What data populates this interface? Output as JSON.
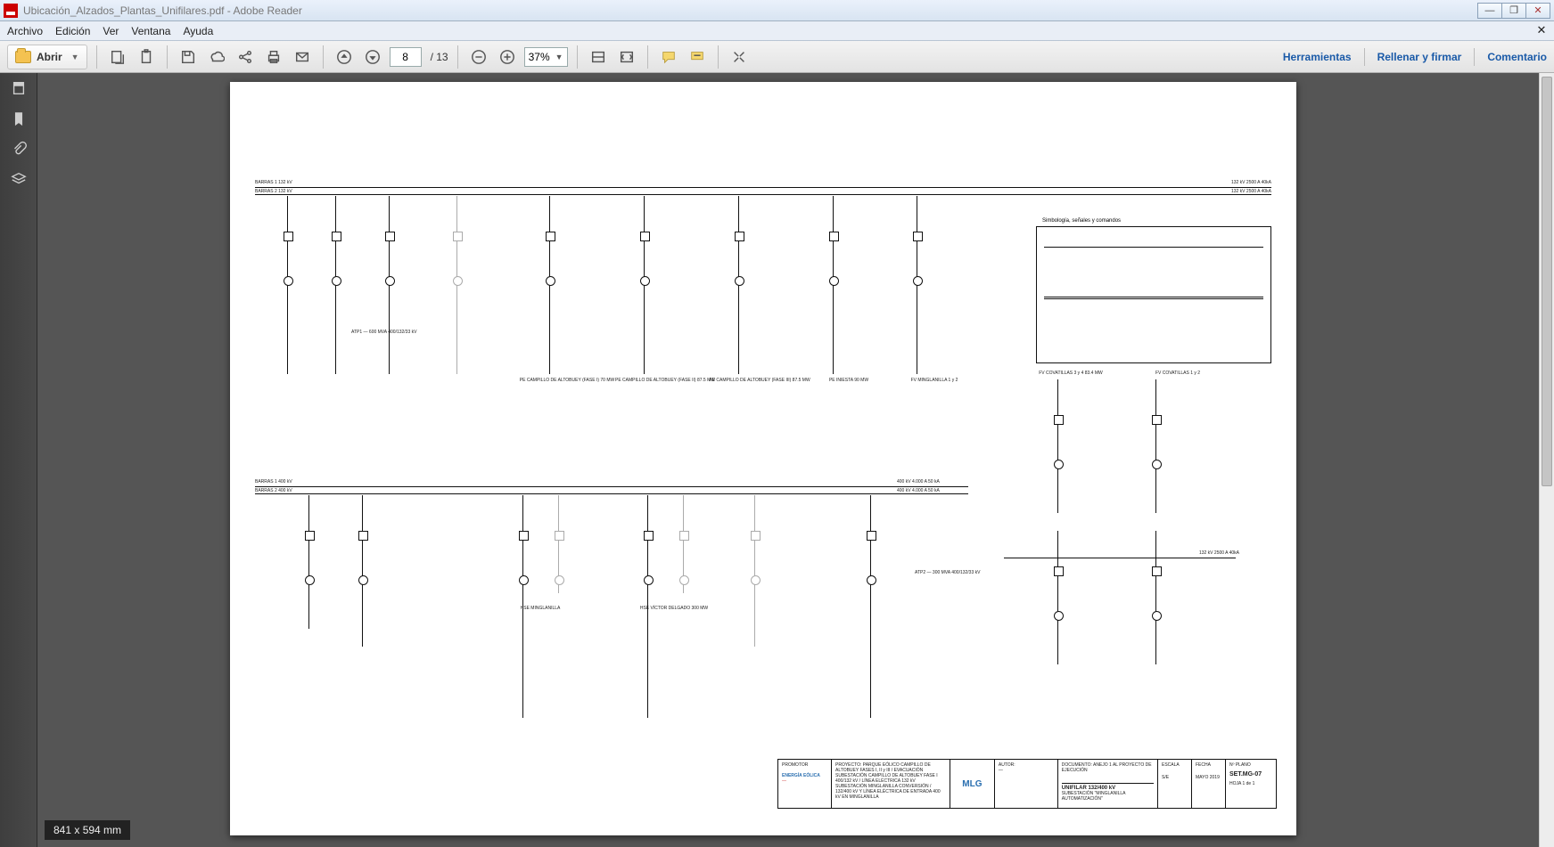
{
  "window": {
    "title": "Ubicación_Alzados_Plantas_Unifilares.pdf - Adobe Reader"
  },
  "menu": {
    "file": "Archivo",
    "edit": "Edición",
    "view": "Ver",
    "window": "Ventana",
    "help": "Ayuda"
  },
  "toolbar": {
    "open_label": "Abrir",
    "page_current": "8",
    "page_total": "/ 13",
    "zoom_value": "37%",
    "right": {
      "tools": "Herramientas",
      "fill_sign": "Rellenar y firmar",
      "comment": "Comentario"
    }
  },
  "status": {
    "dimensions": "841 x 594 mm"
  },
  "document": {
    "bus_labels": {
      "top1": "BARRAS 1  132 kV",
      "top2": "BARRAS 2  132 kV",
      "top_right1": "132 kV  2500 A  40kA",
      "top_right2": "132 kV  2500 A  40kA",
      "mid1": "BARRAS 1  400 kV",
      "mid2": "BARRAS 2  400 kV",
      "mid_right1": "400 kV  4.000 A  50 kA",
      "mid_right2": "400 kV  4.000 A  50 kA"
    },
    "legend_title": "Simbología, señales y comandos",
    "feeders": {
      "f1": "PE CAMPILLO DE ALTOBUEY (FASE I)   70 MW",
      "f2": "PE CAMPILLO DE ALTOBUEY (FASE II)   87.5 MW",
      "f3": "PE CAMPILLO DE ALTOBUEY (FASE III)   87.5 MW",
      "f4": "PE INIESTA   90 MW",
      "f5": "FV MINGLANILLA 1 y 2",
      "sec_left": "HSE MINGLANILLA",
      "sec_mid": "HSE VÍCTOR DELGADO   300 MW",
      "atp1": "ATP1 — 600 MVA  400/132/33 kV",
      "atp2": "ATP2 — 300 MVA  400/132/33 kV",
      "conn_right": "132 kV  2500 A  40kA",
      "pv_r1": "FV COVATILLAS 3 y 4   83.4 MW",
      "pv_r2": "FV COVATILLAS 1 y 2"
    },
    "title_block": {
      "promoter_label": "PROMOTOR",
      "promoter1": "ENERGÍA EÓLICA",
      "promoter2": "—",
      "project": "PROYECTO: PARQUE EÓLICO CAMPILLO DE ALTOBUEY FASES I, II y III / EVACUACIÓN SUBESTACIÓN CAMPILLO DE ALTOBUEY FASE I 400/132 kV / LÍNEA ELÉCTRICA 132 kV SUBESTACIÓN MINGLANILLA CONVERSIÓN / 132/400 kV Y LÍNEA ELÉCTRICA DE ENTRADA 400 kV EN MINGLANILLA",
      "logo": "MLG",
      "author_label": "AUTOR:",
      "author": "—",
      "doc_label": "DOCUMENTO:",
      "doc": "ANEJO 1 AL PROYECTO DE EJECUCIÓN",
      "drawing_label": "UNIFILAR 132/400 kV",
      "drawing_sub": "SUBESTACIÓN \"MINGLANILLA AUTOMATIZACIÓN\"",
      "scale_label": "ESCALA",
      "scale": "S/E",
      "date_label": "FECHA",
      "date": "MAYO 2019",
      "sheet_label": "Nº PLANO",
      "sheet": "SET.MG-07",
      "page": "HOJA 1 de 1"
    }
  }
}
